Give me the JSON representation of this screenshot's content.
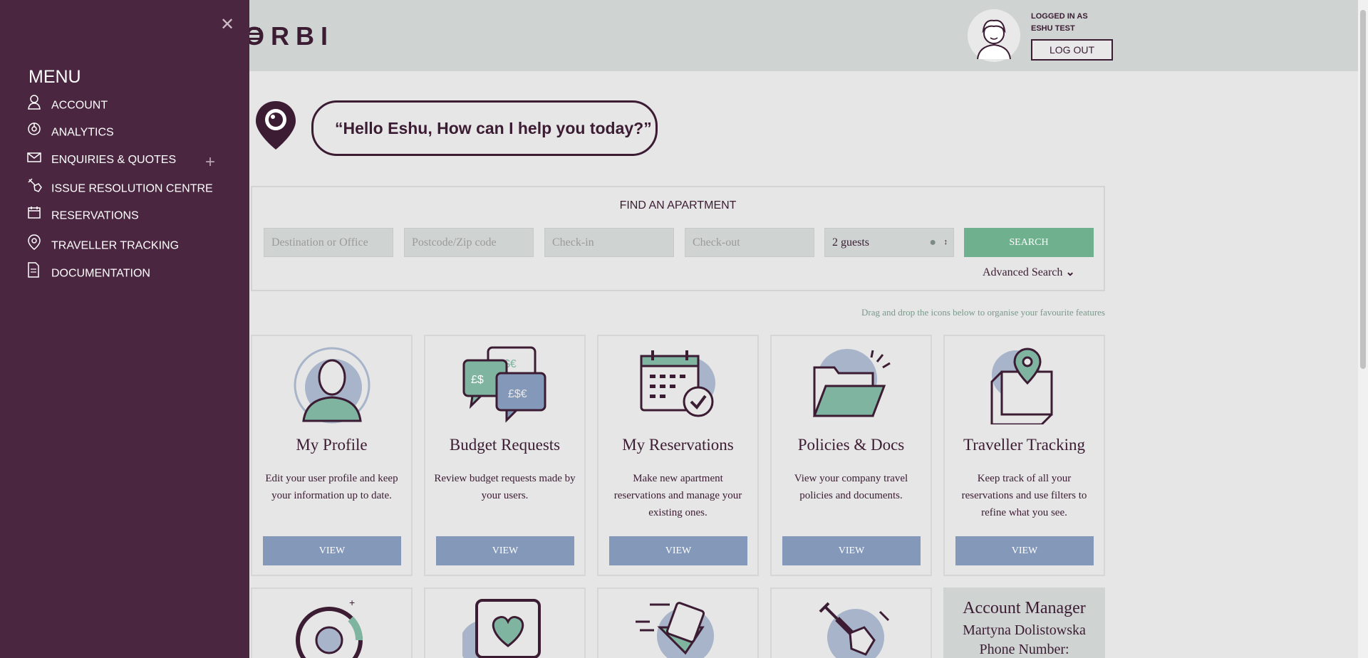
{
  "header": {
    "logo": "ORBI",
    "logged_in_as": "LOGGED IN AS",
    "user_name": "ESHU TEST",
    "logout_label": "LOG OUT"
  },
  "greeting": "“Hello Eshu, How can I help you today?”",
  "search": {
    "title": "FIND AN APARTMENT",
    "destination_placeholder": "Destination or Office",
    "postcode_placeholder": "Postcode/Zip code",
    "checkin_placeholder": "Check-in",
    "checkout_placeholder": "Check-out",
    "guests_value": "2 guests",
    "search_label": "SEARCH",
    "advanced_label": "Advanced Search"
  },
  "drag_hint": "Drag and drop the icons below to organise your favourite features",
  "cards": [
    {
      "title": "My Profile",
      "desc": "Edit your user profile and keep your information up to date.",
      "view": "VIEW"
    },
    {
      "title": "Budget Requests",
      "desc": "Review budget requests made by your users.",
      "view": "VIEW"
    },
    {
      "title": "My Reservations",
      "desc": "Make new apartment reservations and manage your existing ones.",
      "view": "VIEW"
    },
    {
      "title": "Policies & Docs",
      "desc": "View your company travel policies and documents.",
      "view": "VIEW"
    },
    {
      "title": "Traveller Tracking",
      "desc": "Keep track of all your reservations and use filters to refine what you see.",
      "view": "VIEW"
    }
  ],
  "account_manager": {
    "title": "Account Manager",
    "name": "Martyna Dolistowska",
    "phone_label": "Phone Number:"
  },
  "menu": {
    "title": "MENU",
    "items": [
      {
        "label": "ACCOUNT",
        "icon": "user-icon"
      },
      {
        "label": "ANALYTICS",
        "icon": "analytics-icon"
      },
      {
        "label": "ENQUIRIES & QUOTES",
        "icon": "envelope-icon"
      },
      {
        "label": "ISSUE RESOLUTION CENTRE",
        "icon": "tools-icon"
      },
      {
        "label": "RESERVATIONS",
        "icon": "calendar-icon"
      },
      {
        "label": "TRAVELLER TRACKING",
        "icon": "location-pin-icon"
      },
      {
        "label": "DOCUMENTATION",
        "icon": "document-icon"
      }
    ]
  },
  "colors": {
    "menu_bg": "#4b2640",
    "brand_dark": "#3b1c33",
    "search_green": "#6fb08e",
    "view_blue": "#8499b9"
  }
}
